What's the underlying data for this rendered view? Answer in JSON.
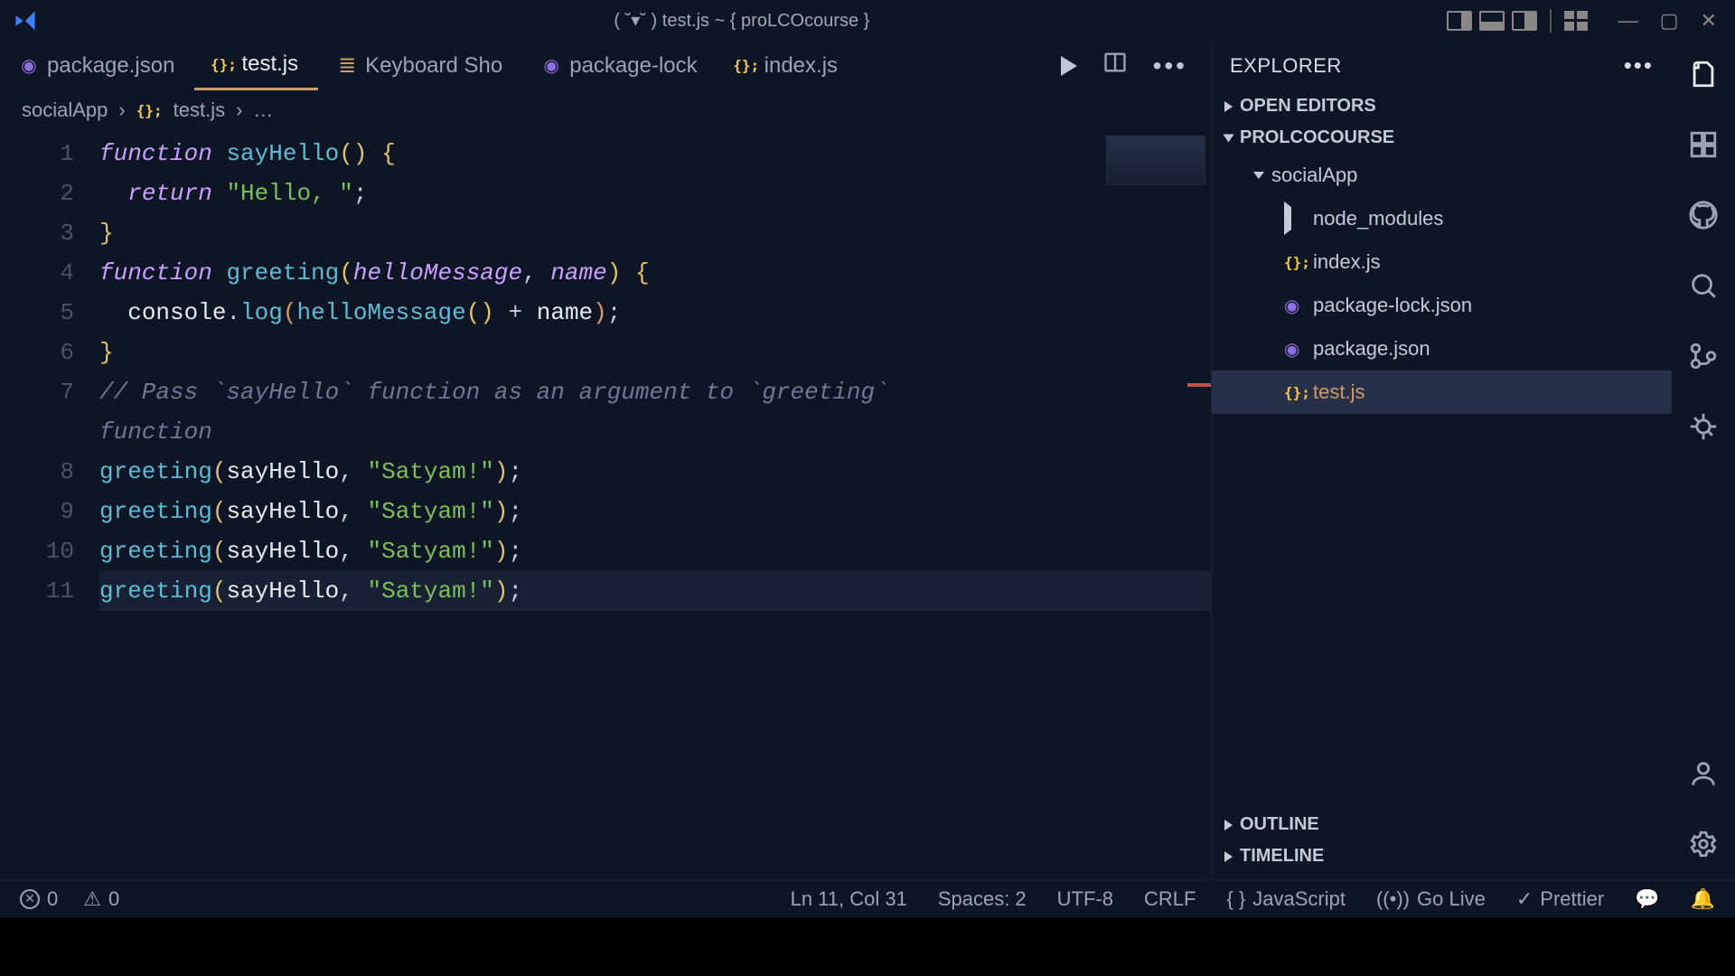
{
  "window": {
    "title": "( ˘▾˘ ) test.js ~ { proLCOcourse }"
  },
  "tabs": [
    {
      "icon": "json",
      "label": "package.json",
      "active": false
    },
    {
      "icon": "js",
      "label": "test.js",
      "active": true
    },
    {
      "icon": "list",
      "label": "Keyboard Sho",
      "active": false
    },
    {
      "icon": "json",
      "label": "package-lock",
      "active": false
    },
    {
      "icon": "js",
      "label": "index.js",
      "active": false
    }
  ],
  "breadcrumb": {
    "root": "socialApp",
    "file_icon": "js",
    "file": "test.js",
    "tail": "…"
  },
  "code": {
    "lines": [
      {
        "n": 1,
        "html": "<span class='kw'>function</span> <span class='fn'>sayHello</span><span class='ylw'>()</span> <span class='ylw'>{</span>"
      },
      {
        "n": 2,
        "html": "  <span class='kw'>return</span> <span class='st'>\"Hello, \"</span><span class='pu'>;</span>"
      },
      {
        "n": 3,
        "html": "<span class='ylw'>}</span>"
      },
      {
        "n": 4,
        "html": "<span class='kw'>function</span> <span class='fn'>greeting</span><span class='ylw'>(</span><span class='id'>helloMessage</span><span class='pu'>,</span> <span class='id'>name</span><span class='ylw'>)</span> <span class='ylw'>{</span>"
      },
      {
        "n": 5,
        "html": "  <span class='prop'>console</span><span class='pu'>.</span><span class='method'>log</span><span class='pn'>(</span><span class='fn'>helloMessage</span><span class='ylw'>()</span> <span class='pu'>+</span> <span class='prop'>name</span><span class='pn'>)</span><span class='pu'>;</span>"
      },
      {
        "n": 6,
        "html": "<span class='ylw'>}</span>"
      },
      {
        "n": 7,
        "html": "<span class='cm'>// Pass `sayHello` function as an argument to `greeting` function</span>",
        "wrap": true
      },
      {
        "n": 8,
        "html": "<span class='fn'>greeting</span><span class='ylw'>(</span><span class='prop'>sayHello</span><span class='pu'>,</span> <span class='st'>\"Satyam!\"</span><span class='ylw'>)</span><span class='pu'>;</span>"
      },
      {
        "n": 9,
        "html": "<span class='fn'>greeting</span><span class='ylw'>(</span><span class='prop'>sayHello</span><span class='pu'>,</span> <span class='st'>\"Satyam!\"</span><span class='ylw'>)</span><span class='pu'>;</span>"
      },
      {
        "n": 10,
        "html": "<span class='fn'>greeting</span><span class='ylw'>(</span><span class='prop'>sayHello</span><span class='pu'>,</span> <span class='st'>\"Satyam!\"</span><span class='ylw'>)</span><span class='pu'>;</span>"
      },
      {
        "n": 11,
        "html": "<span class='fn'>greeting</span><span class='ylw'>(</span><span class='prop'>sayHello</span><span class='pu'>,</span> <span class='st'>\"Satyam!\"</span><span class='ylw'>)</span><span class='pu'>;</span>",
        "current": true
      }
    ]
  },
  "explorer": {
    "title": "EXPLORER",
    "open_editors": "OPEN EDITORS",
    "workspace": "PROLCOCOURSE",
    "folder": "socialApp",
    "items": [
      {
        "kind": "folder",
        "label": "node_modules"
      },
      {
        "kind": "js",
        "label": "index.js"
      },
      {
        "kind": "json",
        "label": "package-lock.json"
      },
      {
        "kind": "json",
        "label": "package.json"
      },
      {
        "kind": "js",
        "label": "test.js",
        "selected": true,
        "accent": true
      }
    ],
    "outline": "OUTLINE",
    "timeline": "TIMELINE"
  },
  "status": {
    "errors": "0",
    "warnings": "0",
    "cursor": "Ln 11, Col 31",
    "spaces": "Spaces: 2",
    "encoding": "UTF-8",
    "eol": "CRLF",
    "lang": "JavaScript",
    "golive": "Go Live",
    "prettier": "Prettier"
  }
}
